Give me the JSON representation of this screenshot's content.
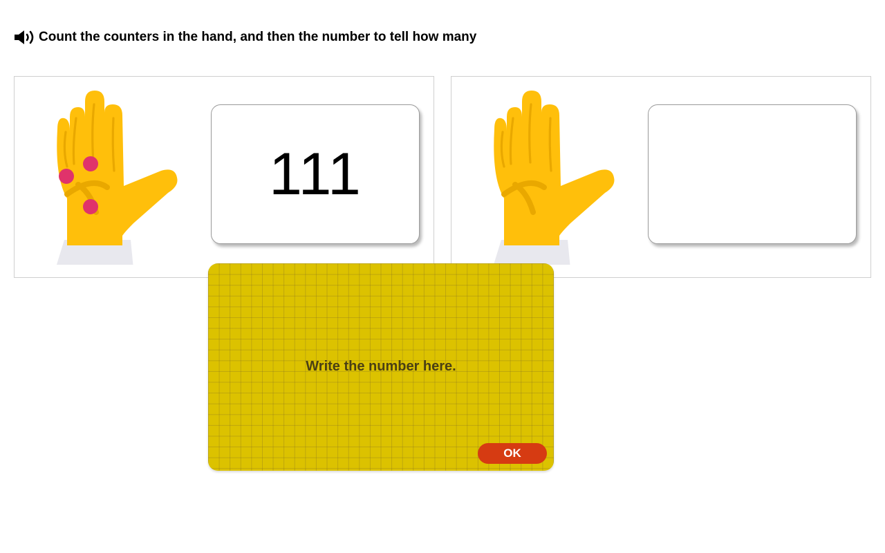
{
  "instruction": {
    "speaker_icon": "speaker-icon",
    "text": "Count the counters in the hand, and then the number to tell how many"
  },
  "panels": [
    {
      "counters": 3,
      "answer": "111"
    },
    {
      "counters": 0,
      "answer": ""
    }
  ],
  "writing_pad": {
    "hint": "Write the number here.",
    "ok_label": "OK"
  },
  "colors": {
    "hand": "#ffbf0b",
    "hand_crease": "#e9a800",
    "sleeve": "#e8e8ee",
    "counter": "#e0336b",
    "pad": "#dcc200",
    "ok_button": "#d63b12"
  }
}
